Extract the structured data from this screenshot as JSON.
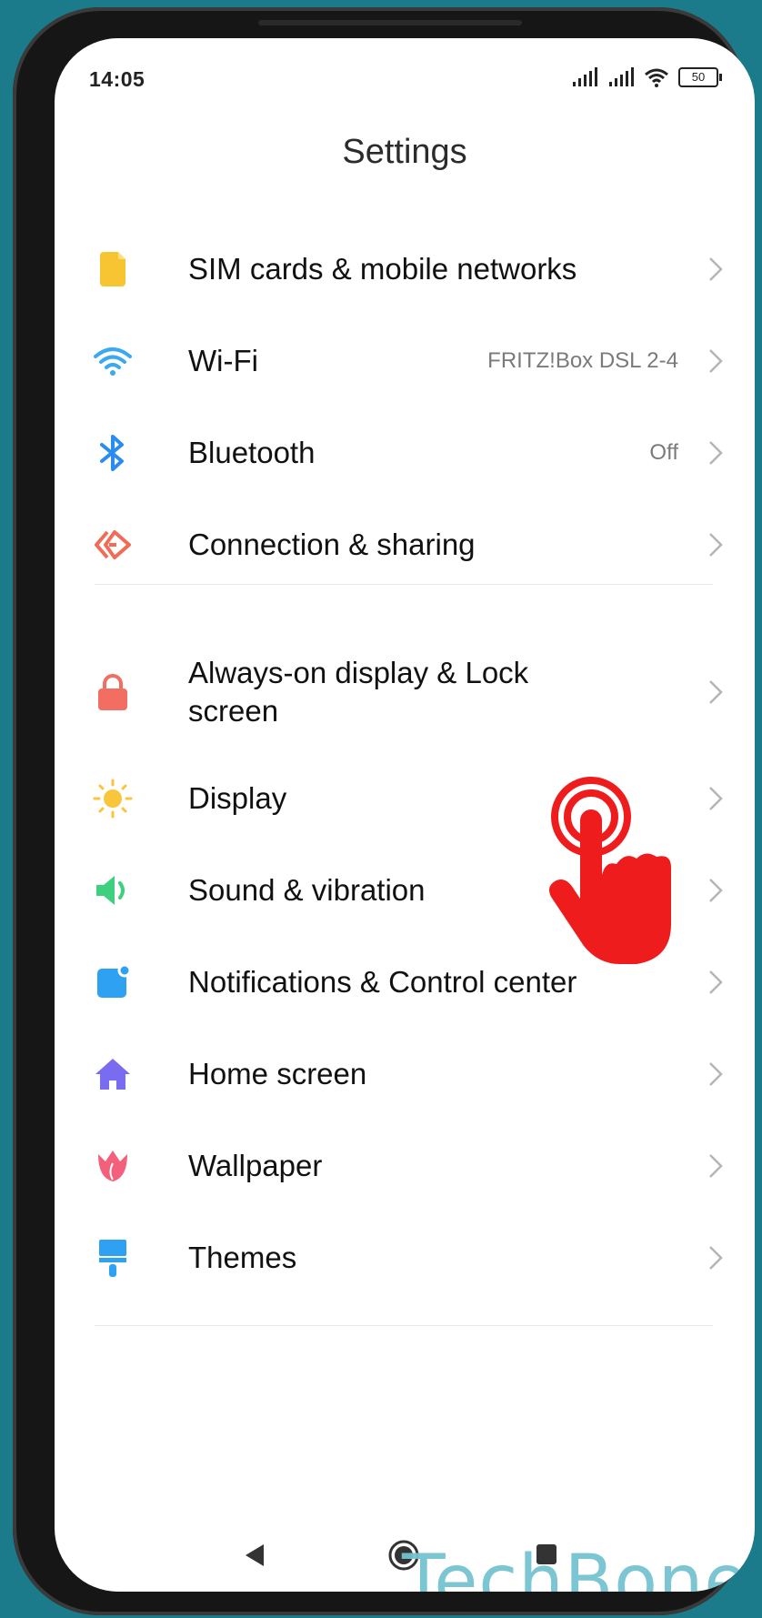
{
  "status": {
    "time": "14:05",
    "battery": "50"
  },
  "page": {
    "title": "Settings"
  },
  "settings": [
    {
      "label": "SIM cards & mobile networks",
      "value": "",
      "icon": "sim-icon",
      "color": "#f7c531"
    },
    {
      "label": "Wi-Fi",
      "value": "FRITZ!Box DSL 2-4",
      "icon": "wifi-icon",
      "color": "#3aa9f0"
    },
    {
      "label": "Bluetooth",
      "value": "Off",
      "icon": "bluetooth-icon",
      "color": "#2a8cf0"
    },
    {
      "label": "Connection & sharing",
      "value": "",
      "icon": "connection-sharing-icon",
      "color": "#f06b58"
    },
    {
      "label": "Always-on display & Lock screen",
      "value": "",
      "icon": "lock-icon",
      "color": "#f26d62"
    },
    {
      "label": "Display",
      "value": "",
      "icon": "sun-icon",
      "color": "#f9c53a"
    },
    {
      "label": "Sound & vibration",
      "value": "",
      "icon": "speaker-icon",
      "color": "#3fd07f"
    },
    {
      "label": "Notifications & Control center",
      "value": "",
      "icon": "notification-icon",
      "color": "#2fa1f2"
    },
    {
      "label": "Home screen",
      "value": "",
      "icon": "home-icon",
      "color": "#7a6cf0"
    },
    {
      "label": "Wallpaper",
      "value": "",
      "icon": "tulip-icon",
      "color": "#f2607b"
    },
    {
      "label": "Themes",
      "value": "",
      "icon": "paintbrush-icon",
      "color": "#2fa1f2"
    }
  ],
  "watermark": "TechBone",
  "overlay": {
    "icon": "tap-hand-icon",
    "color": "#ee1c1c"
  }
}
